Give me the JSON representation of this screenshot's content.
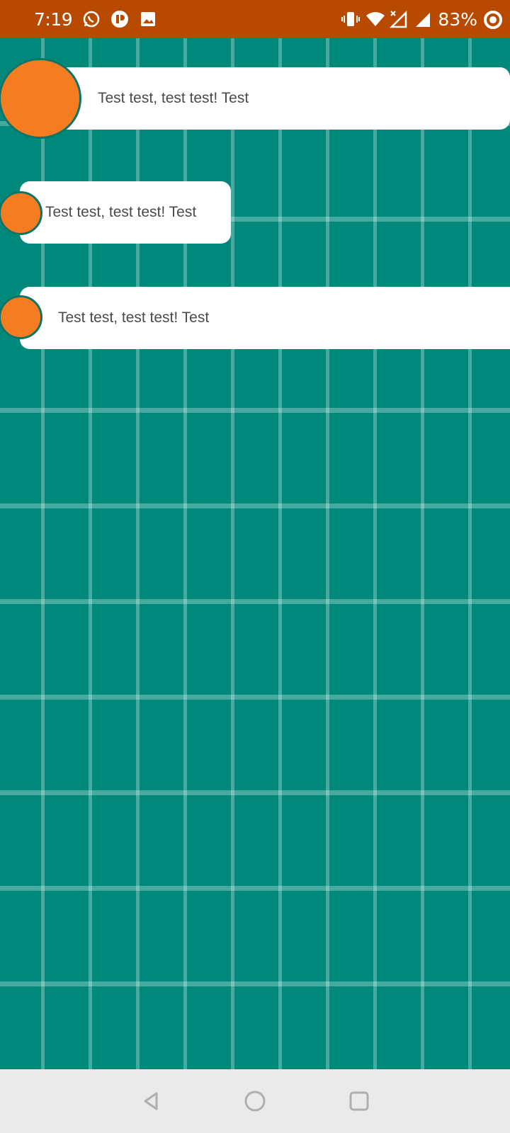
{
  "status_bar": {
    "time": "7:19",
    "battery": "83%",
    "left_icons": [
      "whatsapp-icon",
      "app-notification-icon",
      "image-icon"
    ],
    "right_icons": [
      "vibrate-icon",
      "wifi-icon",
      "signal-x-icon",
      "signal-icon",
      "battery-saver-icon"
    ],
    "color": "#B84A00"
  },
  "messages": [
    {
      "text": "Test test, test test! Test"
    },
    {
      "text": "Test test, test test! Test"
    },
    {
      "text": "Test test, test test! Test"
    }
  ],
  "colors": {
    "background": "#00897B",
    "avatar": "#F57C20",
    "bubble": "#FFFFFF",
    "nav_bar": "#EAEAEA"
  },
  "nav_bar": {
    "buttons": [
      "back-icon",
      "home-icon",
      "recents-icon"
    ]
  }
}
